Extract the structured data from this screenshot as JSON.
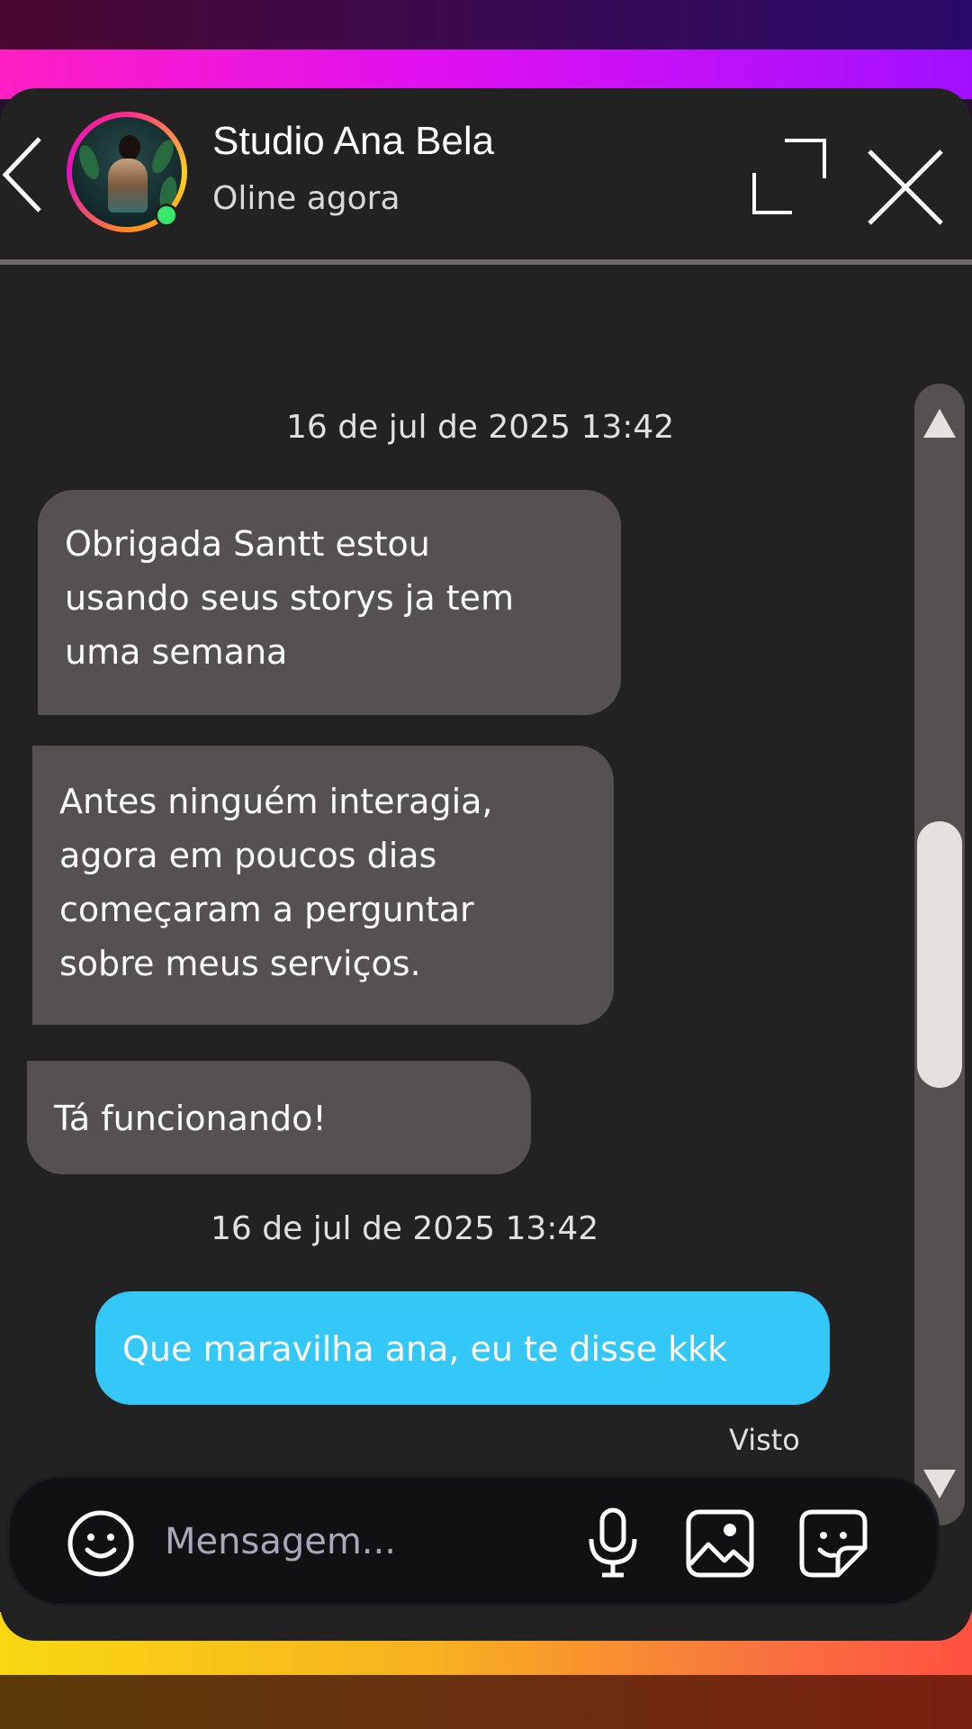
{
  "header": {
    "contact_name": "Studio Ana Bela",
    "status": "Oline agora",
    "icons": [
      "back-icon",
      "avatar",
      "expand-icon",
      "close-icon"
    ]
  },
  "messages": {
    "groups": [
      {
        "timestamp": "16 de jul de 2025 13:42",
        "received": [
          {
            "lines": [
              "Obrigada Santt estou",
              "usando seus storys ja tem",
              "uma semana"
            ]
          },
          {
            "lines": [
              "Antes ninguém interagia,",
              "agora em poucos dias",
              "começaram a perguntar",
              "sobre meus serviços."
            ]
          },
          {
            "lines": [
              "Tá funcionando!"
            ]
          }
        ]
      },
      {
        "timestamp": "16 de jul de 2025 13:42",
        "sent": [
          {
            "text": "Que maravilha ana, eu te disse kkk"
          }
        ],
        "receipt": "Visto"
      }
    ]
  },
  "composer": {
    "placeholder": "Mensagem...",
    "value": "",
    "icons": [
      "emoji-icon",
      "microphone-icon",
      "image-icon",
      "sticker-icon"
    ]
  },
  "scrollbar": {
    "position_fraction": 0.62
  },
  "colors": {
    "window_bg": "#232222",
    "received_bubble": "#555150",
    "sent_bubble": "#34c8f8",
    "online": "#3ae86a"
  }
}
